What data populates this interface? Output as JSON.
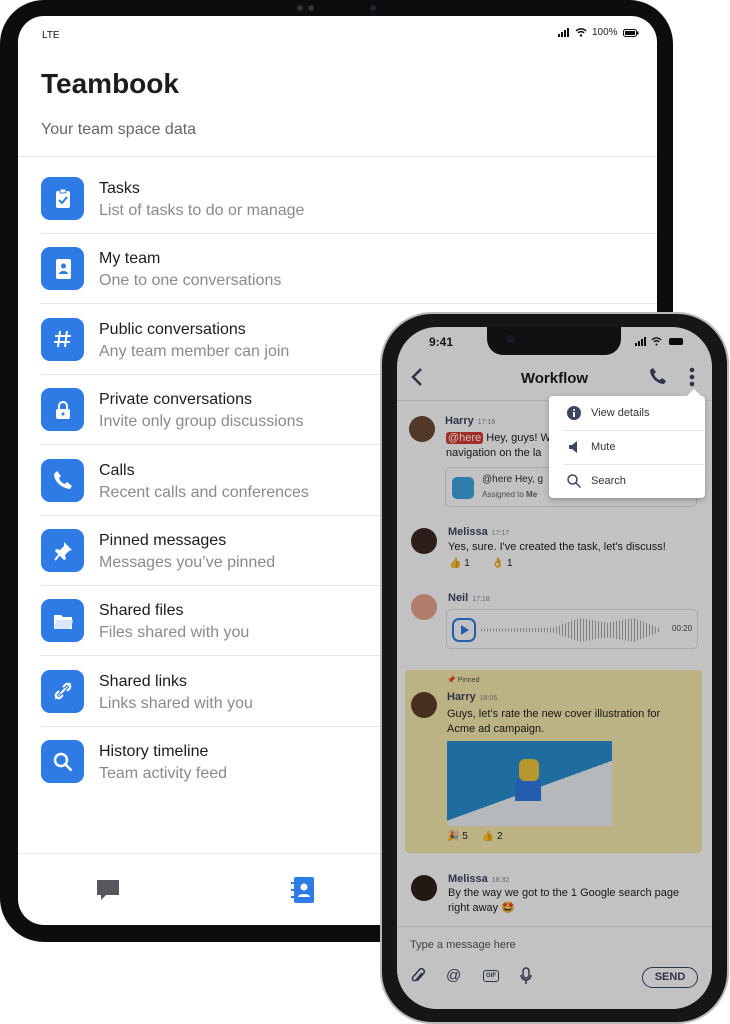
{
  "tablet": {
    "status": {
      "carrier": "LTE",
      "battery": "100%"
    },
    "title": "Teambook",
    "subtitle": "Your team space data",
    "items": [
      {
        "title": "Tasks",
        "subtitle": "List of tasks to do or manage",
        "icon": "clipboard-check-icon"
      },
      {
        "title": "My team",
        "subtitle": "One to one conversations",
        "icon": "contacts-book-icon"
      },
      {
        "title": "Public conversations",
        "subtitle": "Any team member can join",
        "icon": "hash-icon"
      },
      {
        "title": "Private conversations",
        "subtitle": "Invite only group discussions",
        "icon": "lock-icon"
      },
      {
        "title": "Calls",
        "subtitle": "Recent calls and conferences",
        "icon": "phone-icon"
      },
      {
        "title": "Pinned messages",
        "subtitle": "Messages you’ve pinned",
        "icon": "pin-icon"
      },
      {
        "title": "Shared files",
        "subtitle": "Files shared with you",
        "icon": "folder-icon"
      },
      {
        "title": "Shared links",
        "subtitle": "Links shared with you",
        "icon": "link-icon"
      },
      {
        "title": "History timeline",
        "subtitle": "Team activity feed",
        "icon": "search-icon"
      }
    ],
    "accent": "#2f7be5"
  },
  "phone": {
    "time": "9:41",
    "title": "Workflow",
    "menu": [
      "View details",
      "Mute",
      "Search"
    ],
    "messages": [
      {
        "name": "Harry",
        "time": "17:16",
        "mention": "@here",
        "text": "Hey, guys! W",
        "text2": "navigation on the la",
        "card_title": "@here Hey, g",
        "card_sub": "Assigned to",
        "card_user": "Me"
      },
      {
        "name": "Melissa",
        "time": "17:17",
        "text": "Yes, sure. I've created the task, let's discuss!",
        "reactions": [
          {
            "emoji": "👍",
            "count": "1"
          },
          {
            "emoji": "👌",
            "count": "1"
          }
        ]
      },
      {
        "name": "Neil",
        "time": "17:18",
        "duration": "00:20"
      },
      {
        "pinned_label": "Pinned",
        "name": "Harry",
        "time": "18:06",
        "text": "Guys, let’s rate the new cover illustration for Acme ad campaign.",
        "reactions": [
          {
            "emoji": "🎉",
            "count": "5"
          },
          {
            "emoji": "👍",
            "count": "2"
          }
        ]
      },
      {
        "name": "Melissa",
        "time": "18:32",
        "text": "By the way we got to the 1 Google search page right away 🤩"
      }
    ],
    "input_placeholder": "Type a message here",
    "send_label": "SEND",
    "gif_label": "GIF"
  }
}
